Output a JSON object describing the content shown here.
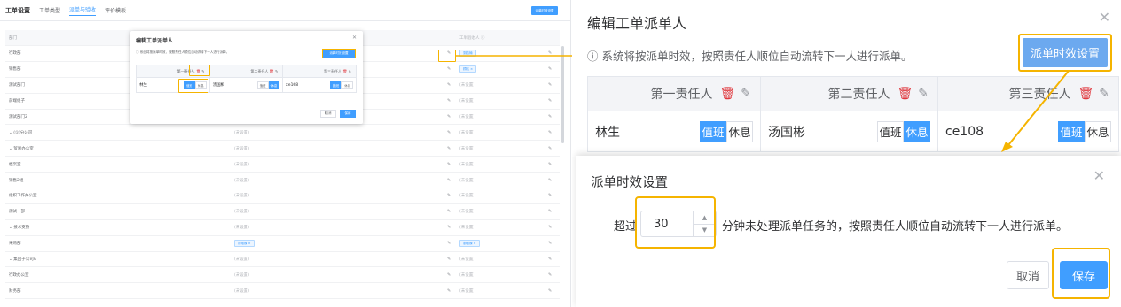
{
  "left": {
    "tabs": [
      "工单设置",
      "工单类型",
      "派单与验收",
      "评价模板"
    ],
    "top_button": "派单时效设置",
    "table": {
      "headers": [
        "部门",
        "",
        "工单验收人 ⓘ"
      ],
      "rows": [
        {
          "dept": "行政部",
          "a": "",
          "b": "张若楠",
          "tagged_b": true
        },
        {
          "dept": "销售部",
          "a": "",
          "b": "顾兆 ×",
          "tagged_b": true
        },
        {
          "dept": "测试部门",
          "a": "",
          "b": "(未设置)"
        },
        {
          "dept": "前端组子",
          "a": "",
          "b": "(未设置)"
        },
        {
          "dept": "测试部门2",
          "a": "",
          "b": "(未设置)"
        },
        {
          "dept": "⌄ (①)分公司",
          "a": "(未设置)",
          "b": "(未设置)"
        },
        {
          "dept": "  ⌄ 贸易办公室",
          "a": "(未设置)",
          "b": "(未设置)"
        },
        {
          "dept": "      档案室",
          "a": "(未设置)",
          "b": "(未设置)"
        },
        {
          "dept": "      销售2组",
          "a": "(未设置)",
          "b": "(未设置)"
        },
        {
          "dept": "    组织工作办公室",
          "a": "(未设置)",
          "b": "(未设置)"
        },
        {
          "dept": "    测试一部",
          "a": "(未设置)",
          "b": "(未设置)"
        },
        {
          "dept": "  ⌄ 技术支持",
          "a": "(未设置)",
          "b": "(未设置)"
        },
        {
          "dept": "      采购部",
          "a": "廖维巍 ×",
          "b": "廖维巍 ×",
          "tagged_a": true,
          "tagged_b": true
        },
        {
          "dept": "⌄ 集团子公司A",
          "a": "(未设置)",
          "b": "(未设置)"
        },
        {
          "dept": "    行政办公室",
          "a": "(未设置)",
          "b": "(未设置)"
        },
        {
          "dept": "    财务部",
          "a": "(未设置)",
          "b": "(未设置)"
        }
      ]
    },
    "mini_dialog": {
      "title": "编辑工单派单人",
      "info": "ⓘ 系统将按派单时效，按照责任人顺位自动流转下一人进行派单。",
      "rule_button": "派单时效设置",
      "headers": [
        "第一责任人",
        "第二责任人",
        "第三责任人"
      ],
      "people": [
        {
          "name": "林生",
          "duty": "值班",
          "rest": "休息",
          "active": "duty"
        },
        {
          "name": "汤国彬",
          "duty": "值班",
          "rest": "休息",
          "active": "duty"
        },
        {
          "name": "ce108",
          "duty": "值班",
          "rest": "休息",
          "active": "duty"
        }
      ],
      "cancel": "取消",
      "save": "保存"
    }
  },
  "right": {
    "title": "编辑工单派单人",
    "info": "ⓘ 系统将按派单时效，按照责任人顺位自动流转下一人进行派单。",
    "rule_button": "派单时效设置",
    "headers": [
      "第一责任人",
      "第二责任人",
      "第三责任人"
    ],
    "people": [
      {
        "name": "林生",
        "duty": "值班",
        "rest": "休息",
        "active": "duty"
      },
      {
        "name": "汤国彬",
        "duty": "值班",
        "rest": "休息",
        "active": "rest"
      },
      {
        "name": "ce108",
        "duty": "值班",
        "rest": "休息",
        "active": "duty"
      }
    ],
    "timeout_dialog": {
      "title": "派单时效设置",
      "prefix": "超过",
      "value": "30",
      "suffix": "分钟未处理派单任务的，按照责任人顺位自动流转下一人进行派单。",
      "cancel": "取消",
      "save": "保存"
    }
  },
  "colors": {
    "primary": "#409eff",
    "highlight": "#f5b400",
    "delete": "#e0383e"
  }
}
